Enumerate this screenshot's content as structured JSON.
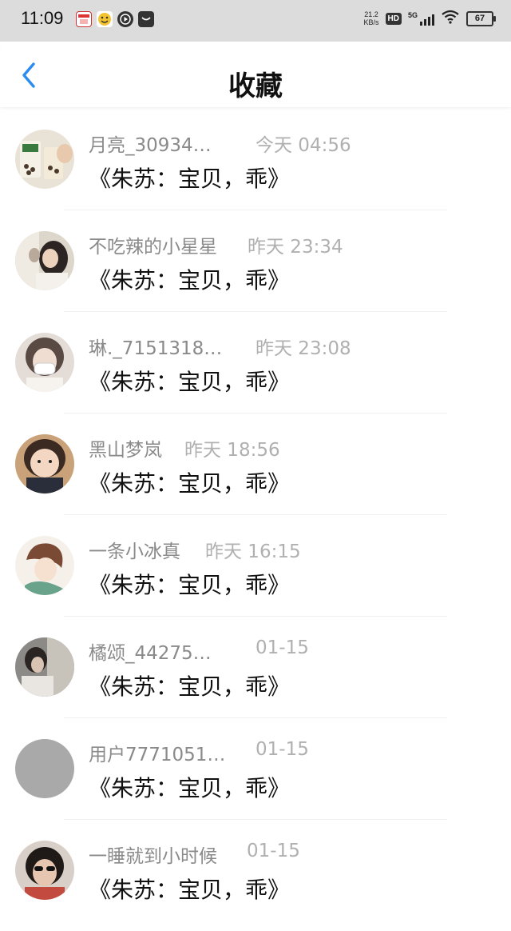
{
  "status_bar": {
    "time": "11:09",
    "net_speed_value": "21.2",
    "net_speed_unit": "KB/s",
    "hd_label": "HD",
    "signal_label": "5G",
    "battery_level": "67",
    "app_icons": [
      "calendar-app-icon",
      "emoji-app-icon",
      "media-app-icon",
      "message-app-icon"
    ]
  },
  "header": {
    "back_icon": "chevron-left-icon",
    "title": "收藏"
  },
  "favorites": [
    {
      "username": "月亮_30934…",
      "time": "今天 04:56",
      "title": "《朱苏：宝贝，乖》"
    },
    {
      "username": "不吃辣的小星星",
      "time": "昨天 23:34",
      "title": "《朱苏：宝贝，乖》"
    },
    {
      "username": "琳._7151318…",
      "time": "昨天 23:08",
      "title": "《朱苏：宝贝，乖》"
    },
    {
      "username": "黑山梦岚",
      "time": "昨天 18:56",
      "title": "《朱苏：宝贝，乖》"
    },
    {
      "username": "一条小冰真",
      "time": "昨天 16:15",
      "title": "《朱苏：宝贝，乖》"
    },
    {
      "username": "橘颂_44275…",
      "time": "01-15",
      "title": "《朱苏：宝贝，乖》"
    },
    {
      "username": "用户7771051…",
      "time": "01-15",
      "title": "《朱苏：宝贝，乖》"
    },
    {
      "username": "一睡就到小时候",
      "time": "01-15",
      "title": "《朱苏：宝贝，乖》"
    }
  ],
  "colors": {
    "accent": "#2a8cf0",
    "status_bar_bg": "#dcdcdc",
    "username": "#8a8a8a",
    "timestamp": "#b0b0b0",
    "title": "#111111"
  }
}
